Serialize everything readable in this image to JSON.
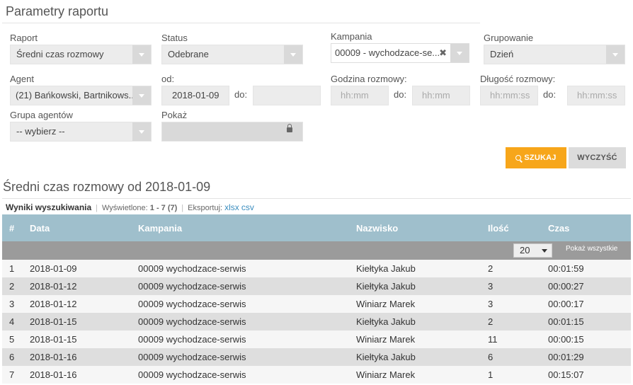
{
  "params": {
    "title": "Parametry raportu",
    "raport": {
      "label": "Raport",
      "value": "Średni czas rozmowy"
    },
    "status": {
      "label": "Status",
      "value": "Odebrane"
    },
    "kampania": {
      "label": "Kampania",
      "value": "00009 - wychodzace-se..."
    },
    "grupowanie": {
      "label": "Grupowanie",
      "value": "Dzień"
    },
    "agent": {
      "label": "Agent",
      "value": "(21) Bańkowski, Bartnikows..."
    },
    "od": {
      "label": "od:",
      "value": "2018-01-09",
      "do_label": "do:",
      "do_value": ""
    },
    "godzina": {
      "label": "Godzina rozmowy:",
      "from_placeholder": "hh:mm",
      "do_label": "do:",
      "to_placeholder": "hh:mm"
    },
    "dlugosc": {
      "label": "Długość rozmowy:",
      "from_placeholder": "hh:mm:ss",
      "do_label": "do:",
      "to_placeholder": "hh:mm:ss"
    },
    "grupa": {
      "label": "Grupa agentów",
      "value": "-- wybierz --"
    },
    "pokaz": {
      "label": "Pokaż",
      "value": ""
    },
    "search_label": "SZUKAJ",
    "clear_label": "WYCZYŚĆ"
  },
  "results": {
    "title": "Średni czas rozmowy od 2018-01-09",
    "info": {
      "heading": "Wyniki wyszukiwania",
      "displayed_label": "Wyświetlone:",
      "displayed_value": "1 - 7 (7)",
      "export_label": "Eksportuj:",
      "xlsx": "xlsx",
      "csv": "csv"
    },
    "columns": [
      "#",
      "Data",
      "Kampania",
      "Nazwisko",
      "Ilość",
      "Czas"
    ],
    "page_size": "20",
    "show_all": "Pokaż wszystkie",
    "rows": [
      [
        "1",
        "2018-01-09",
        "00009 wychodzace-serwis",
        "Kiełtyka Jakub",
        "2",
        "00:01:59"
      ],
      [
        "2",
        "2018-01-12",
        "00009 wychodzace-serwis",
        "Kiełtyka Jakub",
        "3",
        "00:00:27"
      ],
      [
        "3",
        "2018-01-12",
        "00009 wychodzace-serwis",
        "Winiarz Marek",
        "3",
        "00:00:17"
      ],
      [
        "4",
        "2018-01-15",
        "00009 wychodzace-serwis",
        "Kiełtyka Jakub",
        "2",
        "00:01:15"
      ],
      [
        "5",
        "2018-01-15",
        "00009 wychodzace-serwis",
        "Winiarz Marek",
        "11",
        "00:00:15"
      ],
      [
        "6",
        "2018-01-16",
        "00009 wychodzace-serwis",
        "Kiełtyka Jakub",
        "6",
        "00:01:29"
      ],
      [
        "7",
        "2018-01-16",
        "00009 wychodzace-serwis",
        "Winiarz Marek",
        "1",
        "00:15:07"
      ]
    ]
  }
}
